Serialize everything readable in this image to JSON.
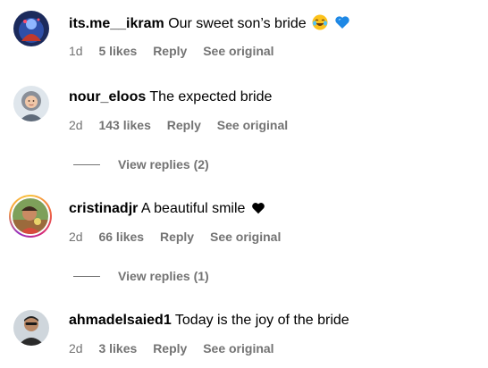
{
  "comments": [
    {
      "username": "its.me__ikram",
      "text": "Our sweet son’s bride",
      "emojis": [
        "laughing-tears-icon",
        "blue-heart-icon"
      ],
      "time": "1d",
      "likes": "5 likes",
      "reply": "Reply",
      "see_original": "See original",
      "avatar": "dark-blue-profile-photo"
    },
    {
      "username": "nour_eloos",
      "text": "The expected bride",
      "time": "2d",
      "likes": "143 likes",
      "reply": "Reply",
      "see_original": "See original",
      "view_replies": "View replies (2)",
      "avatar": "woman-hijab-profile-photo"
    },
    {
      "username": "cristinadjr",
      "text": "A beautiful smile",
      "emojis": [
        "black-heart-icon"
      ],
      "time": "2d",
      "likes": "66 likes",
      "reply": "Reply",
      "see_original": "See original",
      "view_replies": "View replies (1)",
      "avatar": "story-ring-profile-photo"
    },
    {
      "username": "ahmadelsaied1",
      "text": "Today is the joy of the bride",
      "time": "2d",
      "likes": "3 likes",
      "reply": "Reply",
      "see_original": "See original",
      "avatar": "man-profile-photo"
    }
  ],
  "colors": {
    "secondary_text": "#737373",
    "primary_text": "#000000",
    "story_ring_start": "#f9c23c",
    "story_ring_end": "#d62976"
  }
}
